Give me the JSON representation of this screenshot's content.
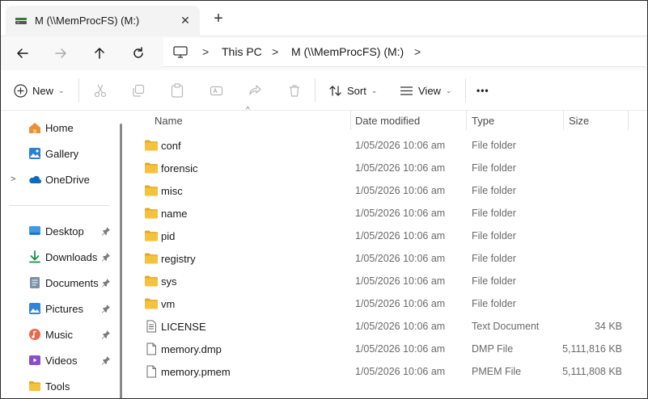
{
  "tab": {
    "title": "M (\\\\MemProcFS) (M:)",
    "close": "✕",
    "new": "+"
  },
  "address": {
    "crumbs": [
      "This PC",
      "M (\\\\MemProcFS) (M:)"
    ],
    "sep": ">"
  },
  "commands": {
    "new": "New",
    "sort": "Sort",
    "view": "View",
    "more": "•••"
  },
  "sidebar": {
    "top": [
      {
        "label": "Home",
        "icon": "home-icon"
      },
      {
        "label": "Gallery",
        "icon": "gallery-icon"
      },
      {
        "label": "OneDrive",
        "icon": "onedrive-icon"
      }
    ],
    "quick": [
      {
        "label": "Desktop",
        "icon": "desktop-icon"
      },
      {
        "label": "Downloads",
        "icon": "downloads-icon"
      },
      {
        "label": "Documents",
        "icon": "documents-icon"
      },
      {
        "label": "Pictures",
        "icon": "pictures-icon"
      },
      {
        "label": "Music",
        "icon": "music-icon"
      },
      {
        "label": "Videos",
        "icon": "videos-icon"
      },
      {
        "label": "Tools",
        "icon": "folder-icon"
      }
    ]
  },
  "columns": {
    "name": "Name",
    "date": "Date modified",
    "type": "Type",
    "size": "Size"
  },
  "files": [
    {
      "name": "conf",
      "date": "1/05/2026 10:06 am",
      "type": "File folder",
      "size": "",
      "kind": "folder"
    },
    {
      "name": "forensic",
      "date": "1/05/2026 10:06 am",
      "type": "File folder",
      "size": "",
      "kind": "folder"
    },
    {
      "name": "misc",
      "date": "1/05/2026 10:06 am",
      "type": "File folder",
      "size": "",
      "kind": "folder"
    },
    {
      "name": "name",
      "date": "1/05/2026 10:06 am",
      "type": "File folder",
      "size": "",
      "kind": "folder"
    },
    {
      "name": "pid",
      "date": "1/05/2026 10:06 am",
      "type": "File folder",
      "size": "",
      "kind": "folder"
    },
    {
      "name": "registry",
      "date": "1/05/2026 10:06 am",
      "type": "File folder",
      "size": "",
      "kind": "folder"
    },
    {
      "name": "sys",
      "date": "1/05/2026 10:06 am",
      "type": "File folder",
      "size": "",
      "kind": "folder"
    },
    {
      "name": "vm",
      "date": "1/05/2026 10:06 am",
      "type": "File folder",
      "size": "",
      "kind": "folder"
    },
    {
      "name": "LICENSE",
      "date": "1/05/2026 10:06 am",
      "type": "Text Document",
      "size": "34 KB",
      "kind": "text"
    },
    {
      "name": "memory.dmp",
      "date": "1/05/2026 10:06 am",
      "type": "DMP File",
      "size": "5,111,816 KB",
      "kind": "file"
    },
    {
      "name": "memory.pmem",
      "date": "1/05/2026 10:06 am",
      "type": "PMEM File",
      "size": "5,111,808 KB",
      "kind": "file"
    }
  ],
  "colors": {
    "folder": "#F4C23D",
    "folder_dark": "#E0A92A",
    "accent": "#0067C0"
  }
}
